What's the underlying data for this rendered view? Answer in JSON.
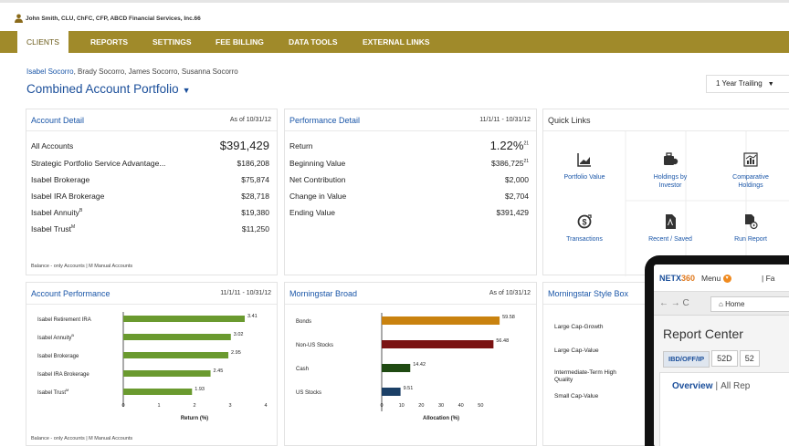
{
  "header": {
    "user_text": "John Smith, CLU, ChFC, CFP, ABCD Financial Services, Inc.66"
  },
  "nav": {
    "tabs": [
      {
        "label": "CLIENTS"
      },
      {
        "label": "REPORTS"
      },
      {
        "label": "SETTINGS"
      },
      {
        "label": "FEE BILLING"
      },
      {
        "label": "DATA TOOLS"
      },
      {
        "label": "EXTERNAL LINKS"
      }
    ],
    "active_tab": "CLIENTS",
    "bar_color": "#a08a2a"
  },
  "household": {
    "linked_name": "Isabel Socorro",
    "other_names": ", Brady Socorro, James Socorro, Susanna Socorro",
    "portfolio_title": "Combined Account Portfolio",
    "period_select": "1 Year Trailing"
  },
  "account_detail": {
    "title": "Account Detail",
    "as_of": "As of 10/31/12",
    "rows": [
      {
        "label": "All Accounts",
        "value": "$391,429"
      },
      {
        "label": "Strategic Portfolio Service Advantage...",
        "value": "$186,208"
      },
      {
        "label": "Isabel Brokerage",
        "value": "$75,874"
      },
      {
        "label": "Isabel IRA Brokerage",
        "value": "$28,718"
      },
      {
        "label": "Isabel Annuity",
        "sup": "B",
        "value": "$19,380"
      },
      {
        "label": "Isabel Trust",
        "sup": "M",
        "value": "$11,250"
      }
    ],
    "footnote": "Balance - only Accounts | M Manual Accounts"
  },
  "performance_detail": {
    "title": "Performance Detail",
    "period": "11/1/11 - 10/31/12",
    "rows": [
      {
        "label": "Return",
        "value": "1.22%",
        "sup": "21"
      },
      {
        "label": "Beginning Value",
        "value": "$386,725",
        "sup": "21"
      },
      {
        "label": "Net Contribution",
        "value": "$2,000"
      },
      {
        "label": "Change in Value",
        "value": "$2,704"
      },
      {
        "label": "Ending Value",
        "value": "$391,429"
      }
    ]
  },
  "quick_links": {
    "title": "Quick Links",
    "items": [
      {
        "label": "Portfolio Value",
        "icon": "portfolio-value-icon"
      },
      {
        "label": "Holdings by Investor",
        "icon": "holdings-icon"
      },
      {
        "label": "Comparative Holdings",
        "icon": "comparative-icon"
      },
      {
        "label": "Transactions",
        "icon": "transactions-icon"
      },
      {
        "label": "Recent / Saved",
        "icon": "pdf-icon"
      },
      {
        "label": "Run Report",
        "icon": "run-report-icon"
      }
    ]
  },
  "account_performance": {
    "title": "Account Performance",
    "period": "11/1/11 - 10/31/12",
    "footnote": "Balance - only Accounts | M Manual Accounts"
  },
  "morningstar_broad": {
    "title": "Morningstar Broad",
    "as_of": "As of 10/31/12"
  },
  "morningstar_style": {
    "title": "Morningstar Style Box",
    "rows": [
      "Large Cap-Growth",
      "Large Cap-Value",
      "Intermediate-Term High Quality",
      "Small Cap-Value"
    ]
  },
  "tablet": {
    "logo_a": "NETX",
    "logo_b": "360",
    "menu": "Menu",
    "fav": "Fa",
    "nav_arrows": "← → C",
    "home": "Home",
    "report_center": "Report Center",
    "tabs": [
      "IBD/OFF/IP",
      "52D",
      "52"
    ],
    "overview": "Overview",
    "sep": "|",
    "all_reports": "All Rep"
  },
  "chart_data": [
    {
      "type": "bar",
      "orientation": "horizontal",
      "categories": [
        "Isabel Retirement IRA",
        "Isabel Annuity",
        "Isabel Brokerage",
        "Isabel IRA Brokerage",
        "Isabel Trust"
      ],
      "category_sups": [
        "",
        "B",
        "",
        "",
        "M"
      ],
      "values": [
        3.41,
        3.02,
        2.95,
        2.45,
        1.93
      ],
      "xlabel": "Return (%)",
      "xlim": [
        0,
        4
      ],
      "ticks": [
        0,
        1,
        2,
        3,
        4
      ],
      "color": "#6a9a2f"
    },
    {
      "type": "bar",
      "orientation": "horizontal",
      "categories": [
        "Bonds",
        "Non-US Stocks",
        "Cash",
        "US Stocks"
      ],
      "values": [
        59.58,
        56.48,
        14.42,
        9.51
      ],
      "colors": [
        "#c9820f",
        "#7a1212",
        "#1f4a12",
        "#1b3f66"
      ],
      "xlabel": "Allocation (%)",
      "xlim": [
        0,
        60
      ],
      "ticks": [
        0,
        10,
        20,
        30,
        40,
        50
      ]
    }
  ]
}
